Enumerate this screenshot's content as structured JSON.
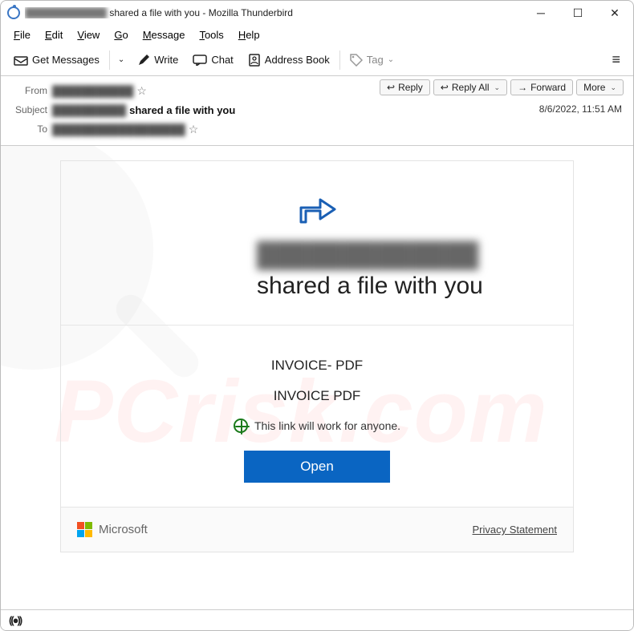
{
  "window": {
    "title_redacted": "████████████",
    "title_suffix": " shared a file with you - Mozilla Thunderbird"
  },
  "menu": {
    "file": "File",
    "edit": "Edit",
    "view": "View",
    "go": "Go",
    "message": "Message",
    "tools": "Tools",
    "help": "Help"
  },
  "toolbar": {
    "get": "Get Messages",
    "write": "Write",
    "chat": "Chat",
    "address": "Address Book",
    "tag": "Tag"
  },
  "header": {
    "from_label": "From",
    "from_value_redacted": "███████████",
    "subject_label": "Subject",
    "subject_redacted": "██████████",
    "subject_suffix": " shared a file with you",
    "to_label": "To",
    "to_value_redacted": "██████████████████",
    "datetime": "8/6/2022, 11:51 AM",
    "reply": "Reply",
    "reply_all": "Reply All",
    "forward": "Forward",
    "more": "More"
  },
  "body": {
    "headline_redacted": "█████████████",
    "headline_suffix": " shared a file with you",
    "line1": "INVOICE- PDF",
    "line2": "INVOICE PDF",
    "link_note": "This link will work for anyone.",
    "open": "Open",
    "ms": "Microsoft",
    "privacy": "Privacy Statement"
  },
  "status": {
    "indicator": "((●))"
  }
}
